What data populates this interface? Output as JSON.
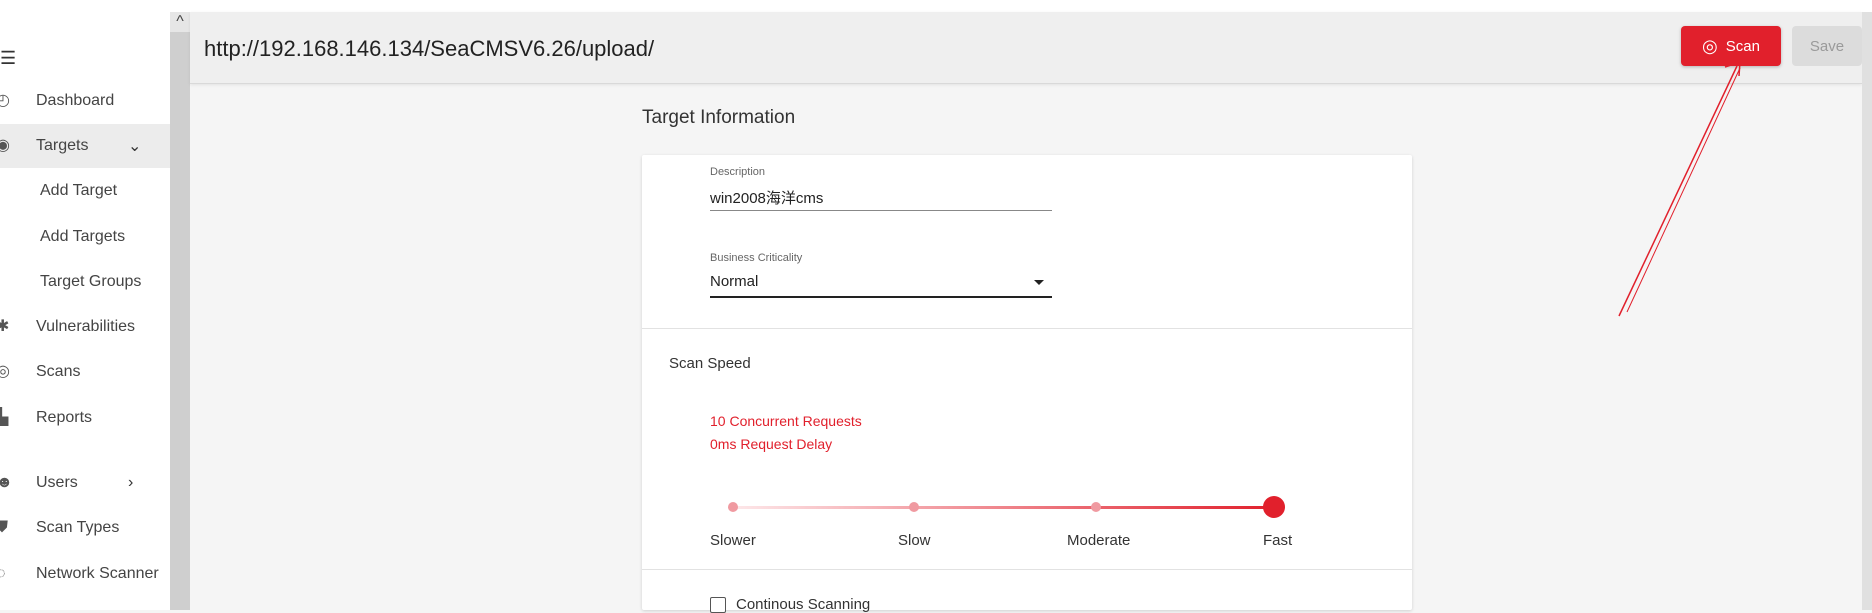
{
  "header": {
    "url": "http://192.168.146.134/SeaCMSV6.26/upload/",
    "scan_label": "Scan",
    "save_label": "Save"
  },
  "sidebar": {
    "collapse_glyph": "^",
    "items": [
      {
        "label": "Dashboard",
        "icon": "dashboard-icon"
      },
      {
        "label": "Targets",
        "icon": "target-icon"
      },
      {
        "label": "Vulnerabilities",
        "icon": "bug-icon"
      },
      {
        "label": "Scans",
        "icon": "scan-icon"
      },
      {
        "label": "Reports",
        "icon": "report-icon"
      },
      {
        "label": "Users",
        "icon": "users-icon"
      },
      {
        "label": "Scan Types",
        "icon": "shield-icon"
      },
      {
        "label": "Network Scanner",
        "icon": "network-icon"
      }
    ],
    "sub_items": [
      "Add Target",
      "Add Targets",
      "Target Groups"
    ]
  },
  "main": {
    "section_title": "Target Information",
    "description_label": "Description",
    "description_value": "win2008海洋cms",
    "criticality_label": "Business Criticality",
    "criticality_value": "Normal",
    "scan_speed_title": "Scan Speed",
    "speed_info_1": "10 Concurrent Requests",
    "speed_info_2": "0ms Request Delay",
    "speed_levels": [
      "Slower",
      "Slow",
      "Moderate",
      "Fast"
    ],
    "selected_speed": "Fast",
    "continuous_label": "Continous Scanning",
    "continuous_checked": false
  },
  "colors": {
    "accent": "#e1202c"
  }
}
